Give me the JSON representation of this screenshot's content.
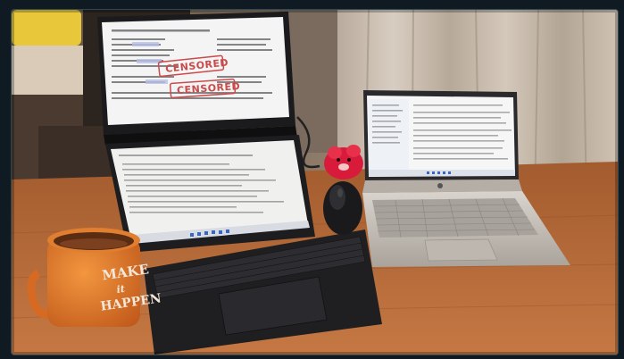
{
  "photo": {
    "stamps": [
      "CENSORED",
      "CENSORED"
    ],
    "mug_lines": [
      "MAKE",
      "it",
      "HAPPEN"
    ],
    "colors": {
      "desk": "#b86c3a",
      "curtain": "#cbbfb2",
      "mug": "#e67b25",
      "laptop_silver": "#c8c3bc",
      "laptop_black": "#1f1f22",
      "plush": "#d81b3a"
    }
  }
}
